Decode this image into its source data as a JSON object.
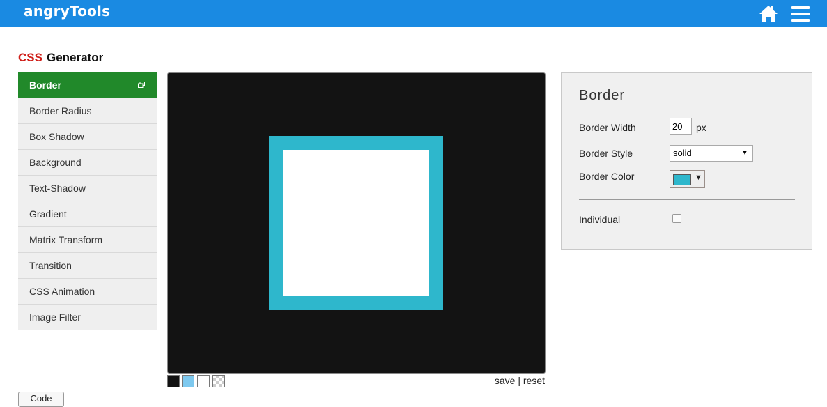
{
  "app": {
    "logo": "angryTools"
  },
  "icons": {
    "home": "home-icon",
    "menu": "hamburger-menu-icon",
    "popout": "popout-window-icon"
  },
  "page": {
    "title_accent": "CSS",
    "title_rest": "Generator"
  },
  "sidebar": {
    "items": [
      {
        "label": "Border",
        "active": true
      },
      {
        "label": "Border Radius"
      },
      {
        "label": "Box Shadow"
      },
      {
        "label": "Background"
      },
      {
        "label": "Text-Shadow"
      },
      {
        "label": "Gradient"
      },
      {
        "label": "Matrix Transform"
      },
      {
        "label": "Transition"
      },
      {
        "label": "CSS Animation"
      },
      {
        "label": "Image Filter"
      }
    ]
  },
  "preview": {
    "background_color": "#131313",
    "box_border_color": "#2eb7cc",
    "save_label": "save",
    "separator": "|",
    "reset_label": "reset",
    "swatch_colors": [
      "#111111",
      "#7ec9ef",
      "#ffffff",
      "transparent-checker"
    ]
  },
  "panel": {
    "title": "Border",
    "border_width": {
      "label": "Border Width",
      "value": "20",
      "unit": "px"
    },
    "border_style": {
      "label": "Border Style",
      "value": "solid"
    },
    "border_color": {
      "label": "Border Color",
      "value": "#2eb7cc"
    },
    "individual": {
      "label": "Individual",
      "checked": false
    }
  },
  "footer": {
    "code_button_label": "Code"
  },
  "colors": {
    "topbar": "#1a8ae2",
    "active_tab": "#21892a",
    "accent_red": "#d0201a"
  }
}
